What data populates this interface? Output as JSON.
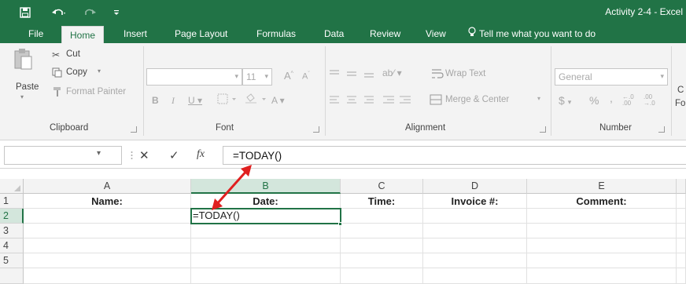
{
  "titlebar": {
    "title": "Activity 2-4 - Excel",
    "save_icon": "save-icon",
    "undo_icon": "undo-icon",
    "redo_icon": "redo-icon",
    "customize_icon": "customize-icon"
  },
  "tabs": [
    "File",
    "Home",
    "Insert",
    "Page Layout",
    "Formulas",
    "Data",
    "Review",
    "View"
  ],
  "active_tab": "Home",
  "tell_me": "Tell me what you want to do",
  "ribbon": {
    "clipboard": {
      "paste": "Paste",
      "cut": "Cut",
      "copy": "Copy",
      "format_painter": "Format Painter",
      "label": "Clipboard"
    },
    "font": {
      "size": "11",
      "label": "Font"
    },
    "alignment": {
      "wrap_text": "Wrap Text",
      "merge_center": "Merge & Center",
      "label": "Alignment"
    },
    "number": {
      "format": "General",
      "label": "Number",
      "currency_sym": "$",
      "percent_sym": "%",
      "comma_sym": ",",
      "inc_decimal": "←.0 .00",
      "dec_decimal": ".00 →.0"
    },
    "cut_off_labels": [
      "C",
      "Fo"
    ]
  },
  "formula_bar": {
    "name_box_value": "",
    "cancel_symbol": "✕",
    "enter_symbol": "✓",
    "fx_symbol": "fx",
    "formula": "=TODAY()"
  },
  "sheet": {
    "columns": [
      "A",
      "B",
      "C",
      "D",
      "E"
    ],
    "rows": [
      "1",
      "2",
      "3",
      "4",
      "5"
    ],
    "row1": [
      "Name:",
      "Date:",
      "Time:",
      "Invoice #:",
      "Comment:"
    ],
    "active_cell_value": "=TODAY()",
    "active_cell_ref": "B2"
  },
  "annotation": {
    "arrow_color": "#e02020"
  },
  "colors": {
    "excel_green": "#217346",
    "ribbon_bg": "#f3f3f3"
  }
}
